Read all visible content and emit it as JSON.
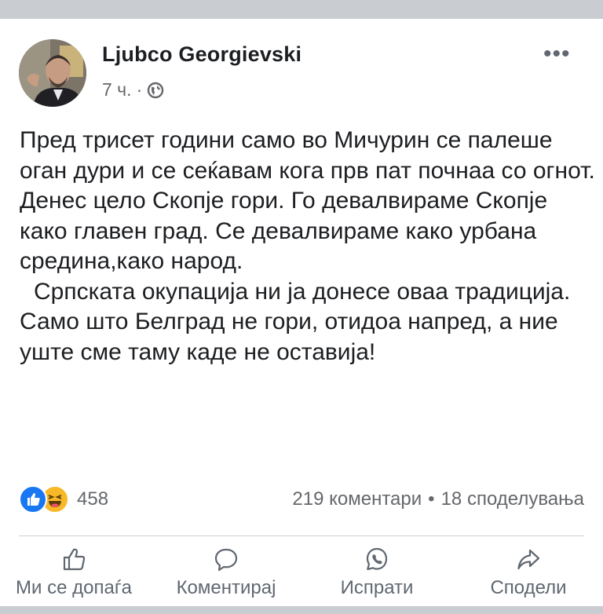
{
  "post": {
    "author": "Ljubco Georgievski",
    "time": "7 ч.",
    "separator": "·",
    "more_label": "•••",
    "paragraphs": [
      "Пред трисет години само во Мичурин се палеше оган дури и се сеќавам кога прв пат почнаа со огнот. Денес цело Скопје гори. Го девалвираме Скопје како главен град. Се девалвираме како урбана средина,како народ.",
      "Српската окупација ни ја донесе оваа традиција. Само што Белград не гори, отидоа напред, а ние уште сме таму каде не оставија!"
    ]
  },
  "engagement": {
    "reaction_icons": [
      "like-icon",
      "haha-icon"
    ],
    "reaction_count": "458",
    "comments": "219 коментари",
    "dot": "•",
    "shares": "18 споделувања"
  },
  "actions": {
    "like": "Ми се допаѓа",
    "comment": "Коментирај",
    "send": "Испрати",
    "share": "Сподели"
  },
  "colors": {
    "text": "#1c1e21",
    "secondary": "#65676b",
    "like_blue": "#1877f2",
    "haha_yellow": "#f7b928",
    "frame": "#c9ccd1"
  }
}
